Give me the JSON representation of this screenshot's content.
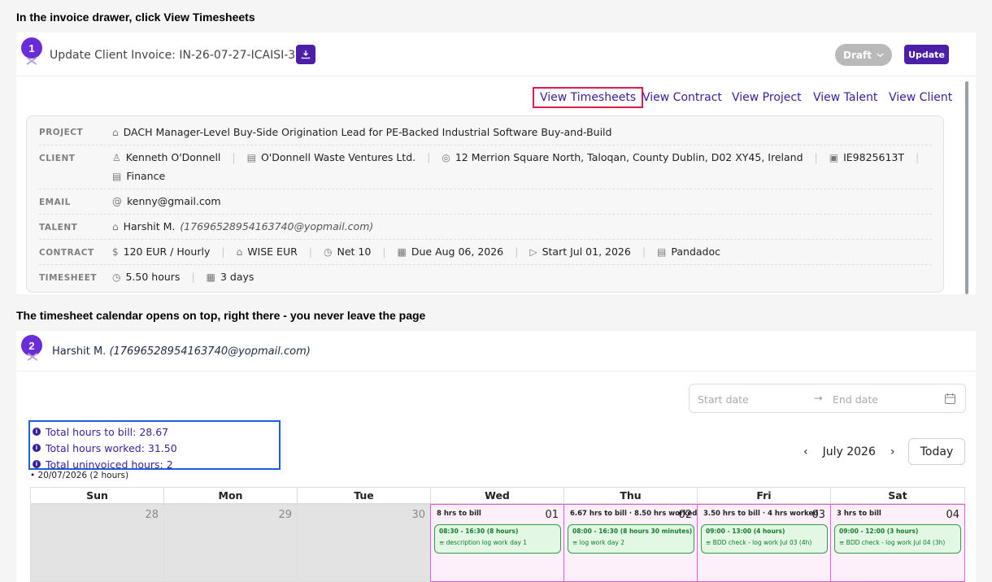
{
  "captions": {
    "step1": "In the invoice drawer, click View Timesheets",
    "step2": "The timesheet calendar opens on top, right there - you never leave the page"
  },
  "drawer": {
    "step_number": "1",
    "title": "Update Client Invoice: IN-26-07-27-ICAISI-3",
    "status": "Draft",
    "update_label": "Update",
    "links": [
      "View Timesheets",
      "View Contract",
      "View Project",
      "View Talent",
      "View Client"
    ],
    "rows": {
      "project": {
        "label": "PROJECT",
        "value": "DACH Manager-Level Buy-Side Origination Lead for PE-Backed Industrial Software Buy-and-Build"
      },
      "client": {
        "label": "CLIENT",
        "name": "Kenneth O'Donnell",
        "company": "O'Donnell Waste Ventures Ltd.",
        "address": "12 Merrion Square North, Taloqan, County Dublin, D02 XY45, Ireland",
        "vat": "IE9825613T",
        "department": "Finance"
      },
      "email": {
        "label": "EMAIL",
        "value": "kenny@gmail.com"
      },
      "talent": {
        "label": "TALENT",
        "name": "Harshit M.",
        "email": "(17696528954163740@yopmail.com)"
      },
      "contract": {
        "label": "CONTRACT",
        "rate": "120 EUR / Hourly",
        "payment": "WISE EUR",
        "terms": "Net 10",
        "due": "Due Aug 06, 2026",
        "start": "Start Jul 01, 2026",
        "signing": "Pandadoc"
      },
      "timesheet": {
        "label": "TIMESHEET",
        "hours": "5.50 hours",
        "days": "3 days"
      }
    }
  },
  "timesheet_modal": {
    "step_number": "2",
    "talent_name": "Harshit M.",
    "talent_email": "(17696528954163740@yopmail.com)",
    "start_placeholder": "Start date",
    "end_placeholder": "End date",
    "totals": [
      "Total hours to bill: 28.67",
      "Total hours worked: 31.50",
      "Total uninvoiced hours: 2"
    ],
    "uninvoiced_dates": "• 20/07/2026 (2 hours)",
    "month": "July 2026",
    "today_label": "Today",
    "weekdays": [
      "Sun",
      "Mon",
      "Tue",
      "Wed",
      "Thu",
      "Fri",
      "Sat"
    ],
    "days": [
      {
        "num": "28"
      },
      {
        "num": "29"
      },
      {
        "num": "30"
      },
      {
        "num": "01",
        "bill": "8 hrs to bill",
        "time": "08:30 - 16:30 (8 hours)",
        "desc": "≡  description log work day 1"
      },
      {
        "num": "02",
        "bill": "6.67 hrs to bill · 8.50 hrs worked",
        "time": "08:00 - 16:30 (8 hours 30 minutes)",
        "desc": "≡  log work day 2"
      },
      {
        "num": "03",
        "bill": "3.50 hrs to bill · 4 hrs worked",
        "time": "09:00 - 13:00 (4 hours)",
        "desc": "≡  BDD check - log work Jul 03 (4h)"
      },
      {
        "num": "04",
        "bill": "3 hrs to bill",
        "time": "09:00 - 12:00 (3 hours)",
        "desc": "≡  BDD check - log work Jul 04 (3h)"
      }
    ]
  },
  "colors": {
    "accent": "#4b1fa8",
    "highlight_red": "#d61e4c",
    "highlight_blue": "#1f5fd6",
    "day_border": "#e15ad6",
    "entry_green": "#2e9d46"
  }
}
